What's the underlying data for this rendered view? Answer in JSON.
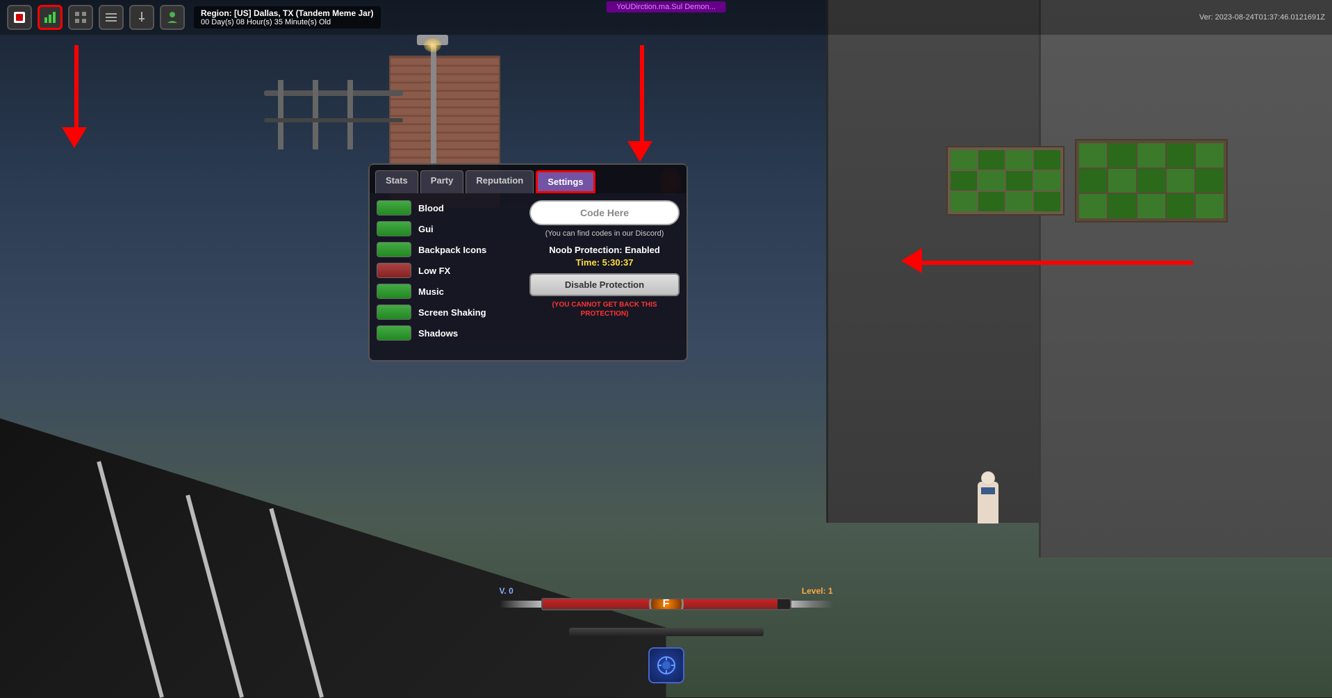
{
  "version": "Ver: 2023-08-24T01:37:46.0121691Z",
  "region": {
    "label": "Region: [US] Dallas, TX (Tandem Meme Jar)",
    "uptime": "00 Day(s) 08 Hour(s) 35 Minute(s) Old"
  },
  "hud": {
    "icons": [
      "■",
      "📊",
      "⠿",
      "📋",
      "⚔",
      "👤"
    ]
  },
  "purple_banner": "YoUDirction.ma.Sul Demon...",
  "tabs": {
    "stats": "Stats",
    "party": "Party",
    "reputation": "Reputation",
    "settings": "Settings"
  },
  "toggles": [
    {
      "label": "Blood",
      "state": "green"
    },
    {
      "label": "Gui",
      "state": "green"
    },
    {
      "label": "Backpack Icons",
      "state": "green"
    },
    {
      "label": "Low FX",
      "state": "red"
    },
    {
      "label": "Music",
      "state": "green"
    },
    {
      "label": "Screen Shaking",
      "state": "green"
    },
    {
      "label": "Shadows",
      "state": "green"
    }
  ],
  "settings_panel": {
    "code_placeholder": "Code Here",
    "discord_hint": "(You can find codes in our Discord)",
    "protection_status": "Noob Protection: Enabled",
    "protection_time_label": "Time:",
    "protection_time": "5:30:37",
    "disable_btn": "Disable Protection",
    "warning": "(YOU CANNOT GET BACK THIS PROTECTION)"
  },
  "xp_bar": {
    "left_label": "V. 0",
    "right_label": "Level: 1",
    "fill_percent": 95
  },
  "arrows": {
    "top_label": "Arrow pointing to highlighted icon",
    "right_label": "Arrow pointing to settings panel"
  }
}
